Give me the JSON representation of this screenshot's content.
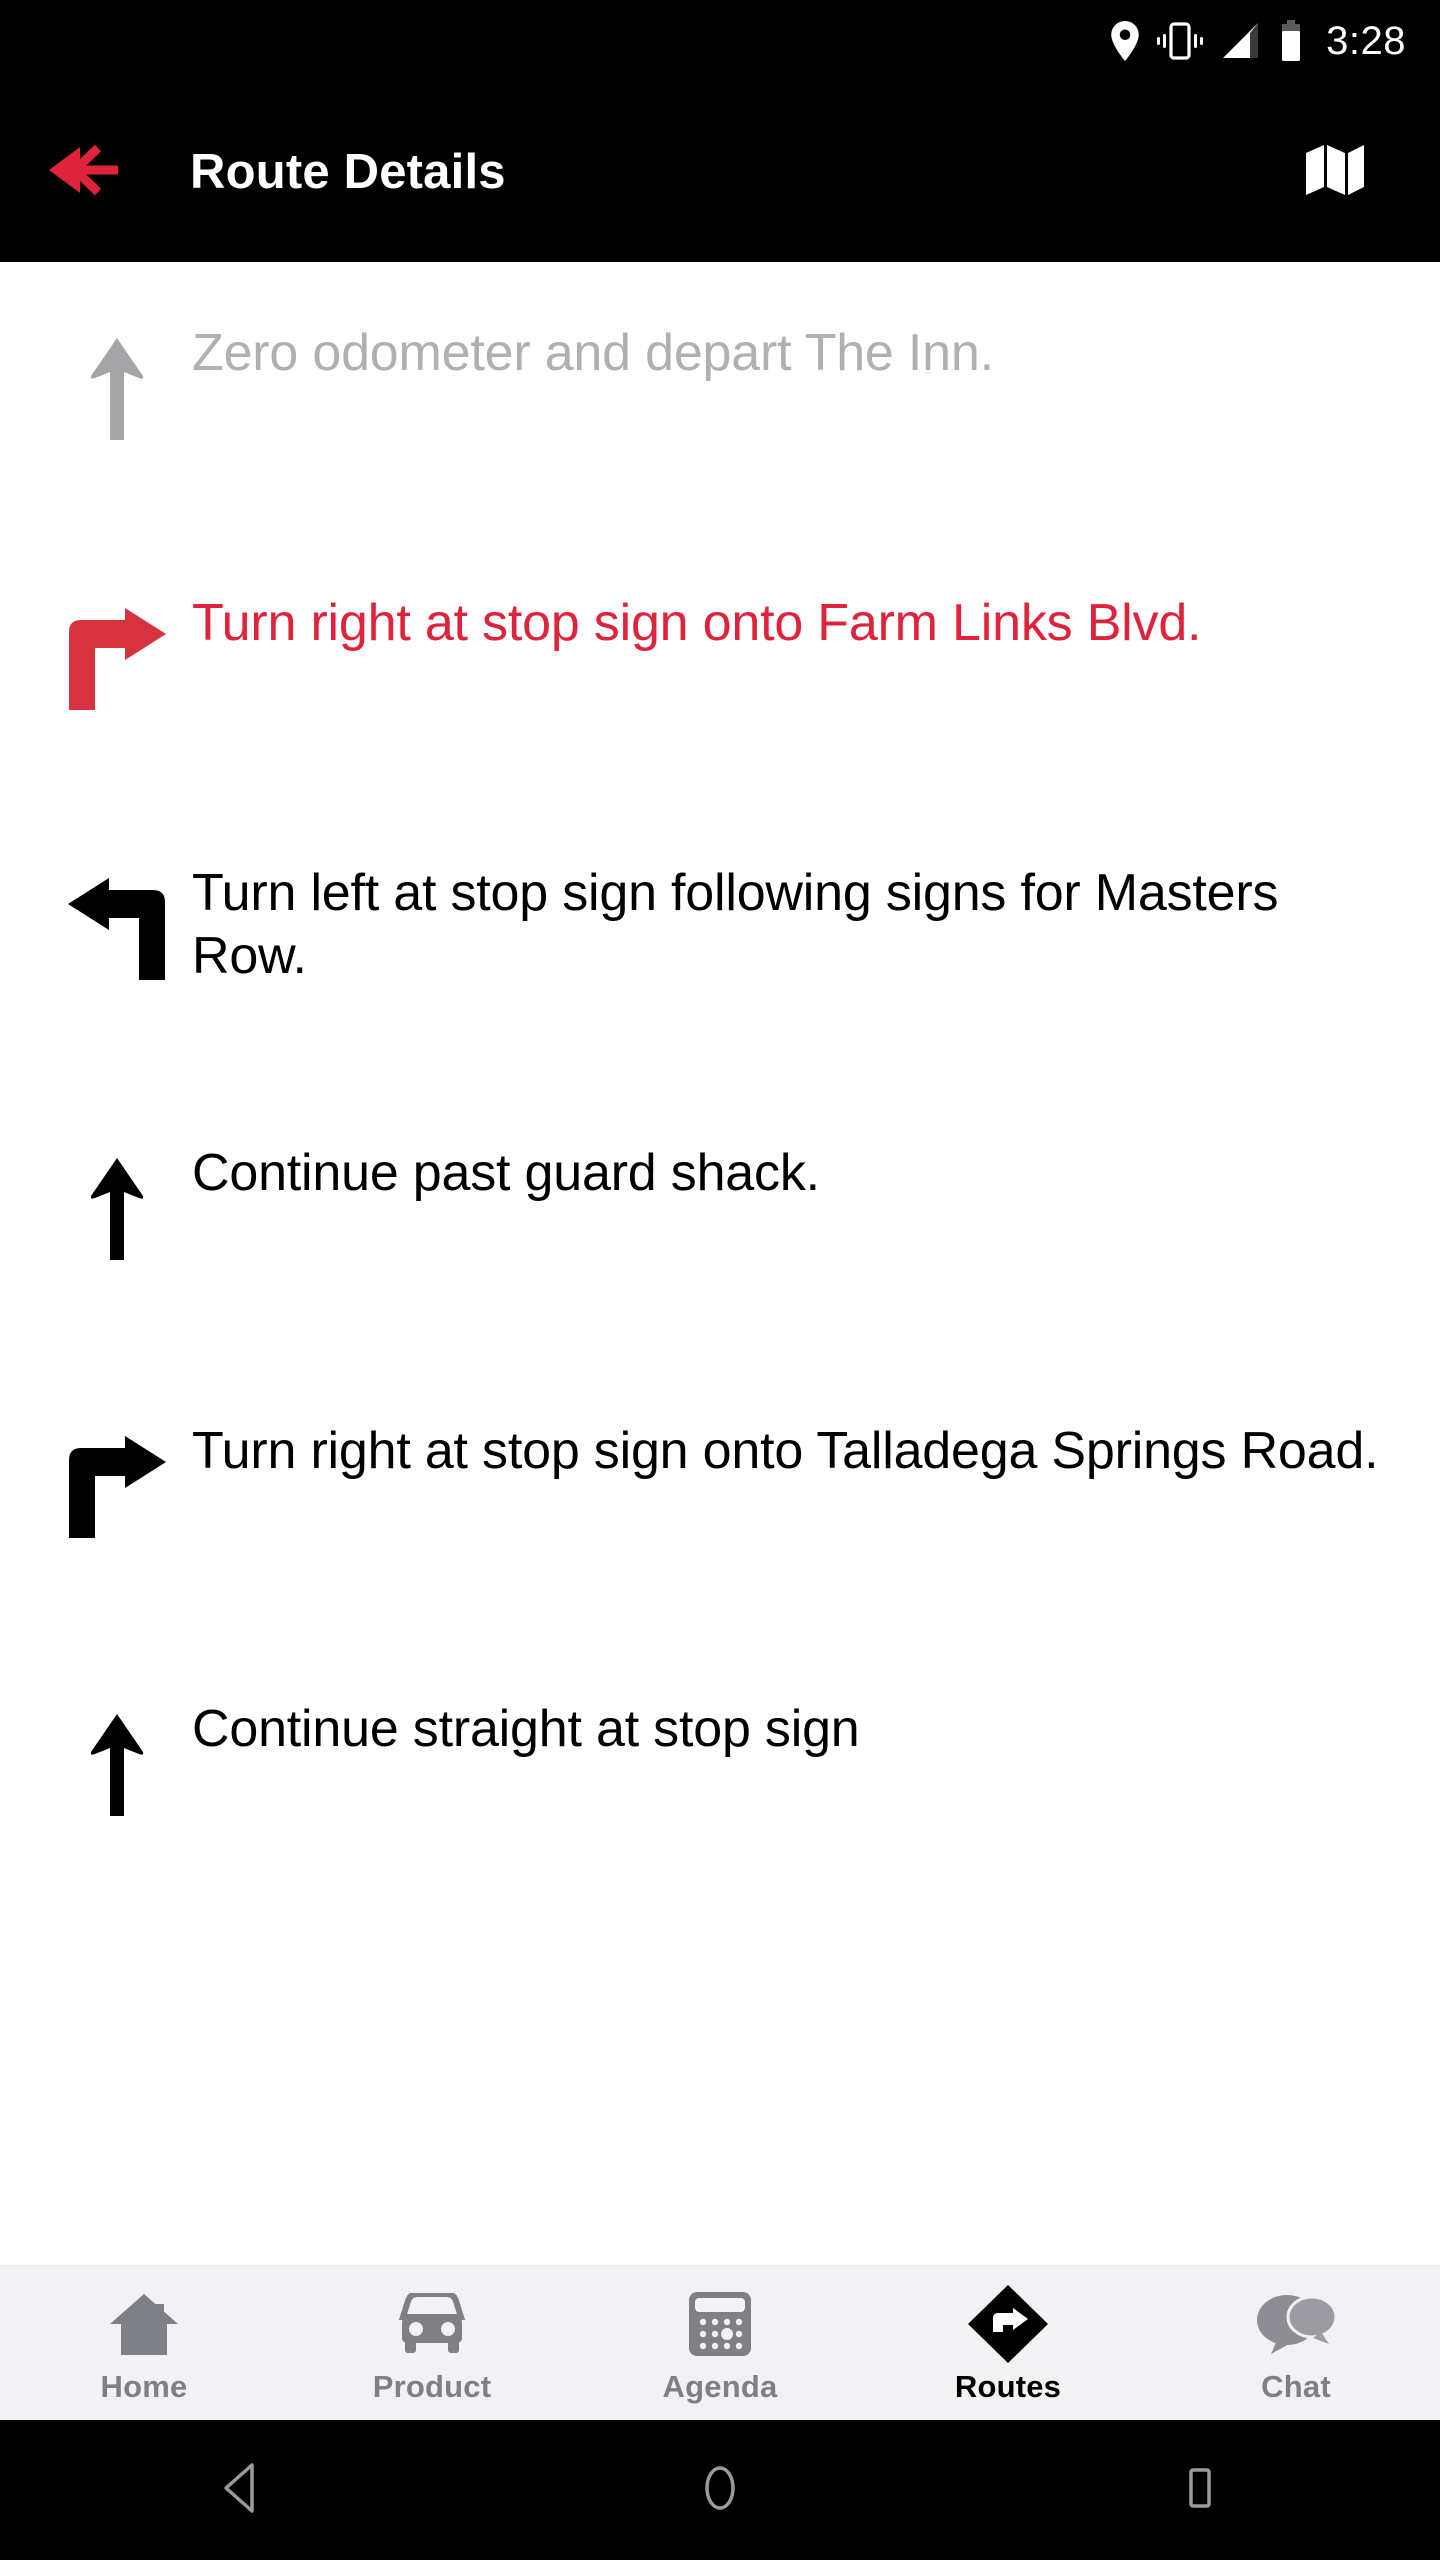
{
  "status_bar": {
    "time": "3:28",
    "icons": [
      "location-pin-icon",
      "vibrate-icon",
      "signal-icon",
      "battery-icon"
    ]
  },
  "app_bar": {
    "title": "Route Details",
    "back_icon": "back-arrow-icon",
    "map_icon": "map-icon",
    "background": "#000000",
    "accent": "#e0233c"
  },
  "route_steps": [
    {
      "text": "Zero odometer and depart The Inn.",
      "icon": "straight-arrow-icon",
      "state": "done",
      "color": "#b0b0b0"
    },
    {
      "text": "Turn right at stop sign onto Farm Links Blvd.",
      "icon": "turn-right-arrow-icon",
      "state": "active",
      "color": "#e0233c"
    },
    {
      "text": "Turn left at stop sign following signs for Masters Row.",
      "icon": "turn-left-arrow-icon",
      "state": "upcoming",
      "color": "#000000"
    },
    {
      "text": "Continue past guard shack.",
      "icon": "straight-arrow-icon",
      "state": "upcoming",
      "color": "#000000"
    },
    {
      "text": "Turn right at stop sign onto Talladega Springs Road.",
      "icon": "turn-right-arrow-icon",
      "state": "upcoming",
      "color": "#000000"
    },
    {
      "text": "Continue straight at stop sign",
      "icon": "straight-arrow-icon",
      "state": "upcoming",
      "color": "#000000"
    }
  ],
  "bottom_nav": {
    "items": [
      {
        "label": "Home",
        "icon": "house-icon",
        "active": false
      },
      {
        "label": "Product",
        "icon": "car-icon",
        "active": false
      },
      {
        "label": "Agenda",
        "icon": "calendar-icon",
        "active": false
      },
      {
        "label": "Routes",
        "icon": "route-diamond-icon",
        "active": true
      },
      {
        "label": "Chat",
        "icon": "chat-bubbles-icon",
        "active": false
      }
    ],
    "background": "#f2f1f3",
    "inactive_color": "#7f7f86",
    "active_color": "#000000"
  },
  "android_nav": {
    "back": "back-triangle-icon",
    "home": "home-circle-icon",
    "recents": "recents-square-icon"
  }
}
